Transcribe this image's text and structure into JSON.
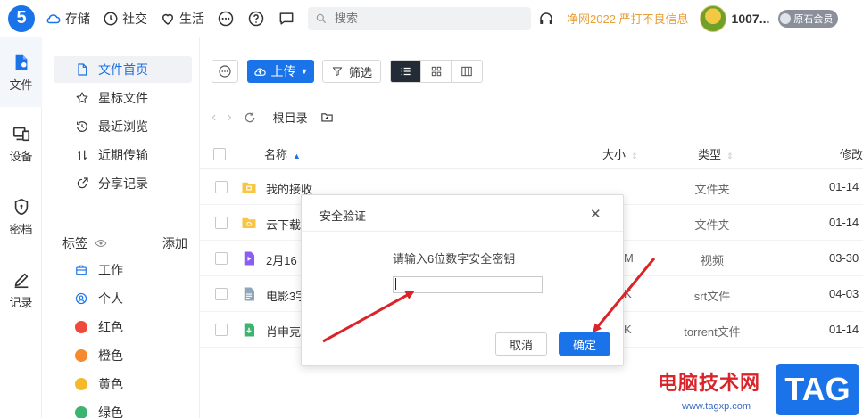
{
  "topbar": {
    "logo": "5",
    "nav": [
      {
        "label": "存储",
        "icon": "cloud-icon"
      },
      {
        "label": "社交",
        "icon": "clock-icon"
      },
      {
        "label": "生活",
        "icon": "heart-icon"
      }
    ],
    "search_placeholder": "搜索",
    "slogan": "净网2022 严打不良信息",
    "username": "1007...",
    "vip_label": "原石会员"
  },
  "rail": [
    {
      "label": "文件",
      "icon": "file-icon",
      "active": true
    },
    {
      "label": "设备",
      "icon": "device-icon",
      "active": false
    },
    {
      "label": "密档",
      "icon": "vault-icon",
      "active": false
    },
    {
      "label": "记录",
      "icon": "pen-icon",
      "active": false
    }
  ],
  "sidebar": {
    "items": [
      {
        "label": "文件首页",
        "icon": "document-icon"
      },
      {
        "label": "星标文件",
        "icon": "star-icon"
      },
      {
        "label": "最近浏览",
        "icon": "history-icon"
      },
      {
        "label": "近期传输",
        "icon": "transfer-icon"
      },
      {
        "label": "分享记录",
        "icon": "share-icon"
      }
    ],
    "tags_title": "标签",
    "tags_add": "添加",
    "tags": [
      {
        "label": "工作",
        "kind": "icon",
        "icon": "briefcase-icon"
      },
      {
        "label": "个人",
        "kind": "icon",
        "icon": "person-icon"
      },
      {
        "label": "红色",
        "kind": "dot",
        "color": "#f04a3c"
      },
      {
        "label": "橙色",
        "kind": "dot",
        "color": "#f58a2e"
      },
      {
        "label": "黄色",
        "kind": "dot",
        "color": "#f7b928"
      },
      {
        "label": "绿色",
        "kind": "dot",
        "color": "#3bb46e"
      }
    ]
  },
  "toolbar": {
    "upload_label": "上传",
    "filter_label": "筛选"
  },
  "path": {
    "root_label": "根目录"
  },
  "table": {
    "headers": {
      "name": "名称",
      "size": "大小",
      "type": "类型",
      "modified": "修改"
    },
    "rows": [
      {
        "name": "我的接收",
        "size": "",
        "type": "文件夹",
        "modified": "01-14",
        "icon": "folder-icon"
      },
      {
        "name": "云下载",
        "size": "",
        "type": "文件夹",
        "modified": "01-14",
        "icon": "folder-icon"
      },
      {
        "name": "2月16",
        "size": "M",
        "type": "视频",
        "modified": "03-30",
        "icon": "video-icon"
      },
      {
        "name": "电影3字",
        "size": "K",
        "type": "srt文件",
        "modified": "04-03",
        "icon": "srt-icon"
      },
      {
        "name": "肖申克",
        "size": "K",
        "type": "torrent文件",
        "modified": "01-14",
        "icon": "torrent-icon"
      }
    ]
  },
  "dialog": {
    "title": "安全验证",
    "prompt": "请输入6位数字安全密钥",
    "input_value": "",
    "cancel_label": "取消",
    "ok_label": "确定"
  },
  "watermark": {
    "site_name": "电脑技术网",
    "url": "www.tagxp.com",
    "tag": "TAG"
  },
  "colors": {
    "accent": "#1a73e8",
    "annotation": "#d9252a",
    "slogan": "#e8a03a"
  }
}
